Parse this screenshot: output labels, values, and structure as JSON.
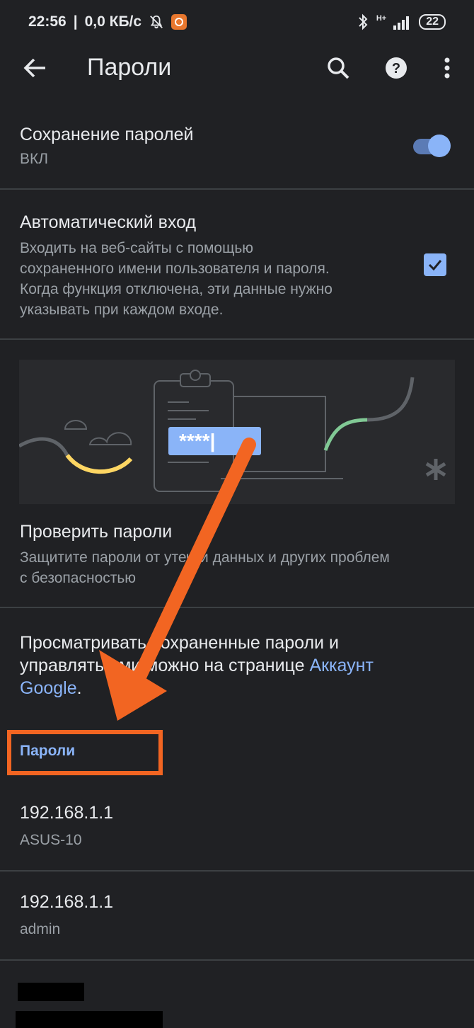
{
  "status": {
    "time": "22:56",
    "speed": "0,0 КБ/с",
    "network": "H+",
    "battery": "22"
  },
  "toolbar": {
    "title": "Пароли",
    "icons": [
      "back-arrow-icon",
      "search-icon",
      "help-icon",
      "more-vert-icon"
    ]
  },
  "save_passwords": {
    "title": "Сохранение паролей",
    "state": "ВКЛ",
    "enabled": true
  },
  "auto_signin": {
    "title": "Автоматический вход",
    "description_lines": [
      "Входить на веб-сайты с помощью",
      "сохраненного имени пользователя и пароля.",
      "Когда функция отключена, эти данные нужно",
      "указывать при каждом входе."
    ],
    "checked": true
  },
  "illustration": {
    "password_mask": "****|"
  },
  "check_passwords": {
    "title": "Проверить пароли",
    "description_lines": [
      "Защитите пароли от утечки данных и других проблем",
      "с безопасностью"
    ]
  },
  "manage_info": {
    "line1": "Просматривать сохраненные пароли и",
    "line2_text": "управлять ими можно на странице ",
    "link_part1": "Аккаунт",
    "link_part2": "Google",
    "suffix": "."
  },
  "passwords_section": {
    "header": "Пароли",
    "entries": [
      {
        "site": "192.168.1.1",
        "username": "ASUS-10"
      },
      {
        "site": "192.168.1.1",
        "username": "admin"
      }
    ]
  },
  "colors": {
    "background": "#202124",
    "accent": "#8ab4f8",
    "annotation": "#f26522"
  }
}
